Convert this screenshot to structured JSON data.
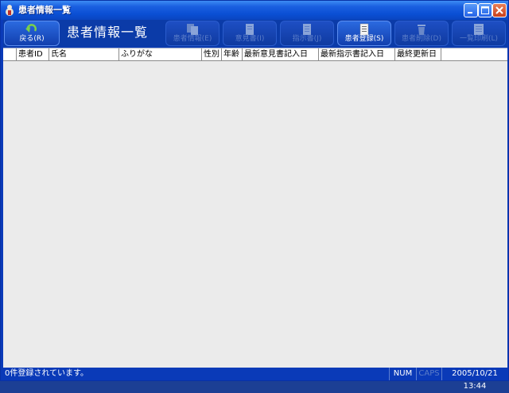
{
  "window": {
    "title": "患者情報一覧"
  },
  "toolbar": {
    "back_label": "戻る(R)",
    "screen_title": "患者情報一覧",
    "buttons": [
      {
        "label": "患者情報(E)",
        "enabled": false,
        "icon": "copy-pages-icon"
      },
      {
        "label": "意見書(I)",
        "enabled": false,
        "icon": "document-icon"
      },
      {
        "label": "指示書(J)",
        "enabled": false,
        "icon": "document-lines-icon"
      },
      {
        "label": "患者登録(S)",
        "enabled": true,
        "icon": "register-document-icon"
      },
      {
        "label": "患者削除(D)",
        "enabled": false,
        "icon": "trash-icon"
      },
      {
        "label": "一覧印刷(L)",
        "enabled": false,
        "icon": "print-list-icon"
      }
    ]
  },
  "table": {
    "columns": [
      "",
      "患者ID",
      "氏名",
      "ふりがな",
      "性別",
      "年齢",
      "最新意見書記入日",
      "最新指示書記入日",
      "最終更新日"
    ],
    "rows": []
  },
  "status": {
    "message": "0件登録されています。",
    "num": "NUM",
    "caps": "CAPS",
    "datetime": "2005/10/21 13:44"
  },
  "colors": {
    "accent": "#0a3ab8",
    "titlebar": "#0a4fd4",
    "table_bg": "#ebebeb"
  }
}
